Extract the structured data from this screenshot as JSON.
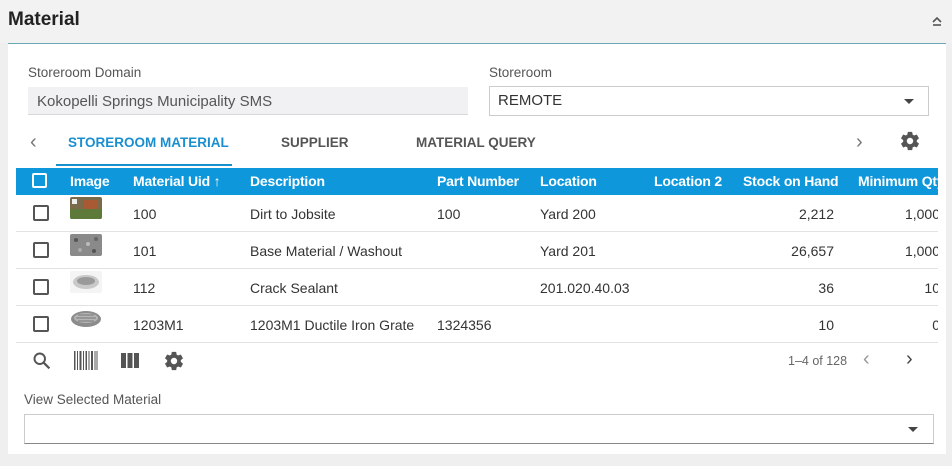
{
  "header": {
    "title": "Material"
  },
  "form": {
    "domain_label": "Storeroom Domain",
    "domain_value": "Kokopelli Springs Municipality SMS",
    "storeroom_label": "Storeroom",
    "storeroom_value": "REMOTE"
  },
  "tabs": [
    {
      "label": "STOREROOM MATERIAL",
      "active": true
    },
    {
      "label": "SUPPLIER",
      "active": false
    },
    {
      "label": "MATERIAL QUERY",
      "active": false
    }
  ],
  "table": {
    "columns": [
      "Image",
      "Material Uid",
      "Description",
      "Part Number",
      "Location",
      "Location 2",
      "Stock on Hand",
      "Minimum Qty"
    ],
    "sort_indicator": "↑",
    "rows": [
      {
        "uid": "100",
        "description": "Dirt to Jobsite",
        "part_number": "100",
        "location": "Yard 200",
        "location2": "",
        "stock": "2,212",
        "min_qty": "1,000"
      },
      {
        "uid": "101",
        "description": "Base Material / Washout",
        "part_number": "",
        "location": "Yard 201",
        "location2": "",
        "stock": "26,657",
        "min_qty": "1,000"
      },
      {
        "uid": "112",
        "description": "Crack Sealant",
        "part_number": "",
        "location": "201.020.40.03",
        "location2": "",
        "stock": "36",
        "min_qty": "10"
      },
      {
        "uid": "1203M1",
        "description": "1203M1 Ductile Iron Grate",
        "part_number": "1324356",
        "location": "",
        "location2": "",
        "stock": "10",
        "min_qty": "0"
      }
    ]
  },
  "pager": {
    "range": "1–4 of 128"
  },
  "view": {
    "label": "View Selected Material",
    "value": ""
  },
  "colors": {
    "accent": "#0f97dc",
    "tab_active": "#1a8fd0",
    "header_line": "#6aa6b3"
  }
}
